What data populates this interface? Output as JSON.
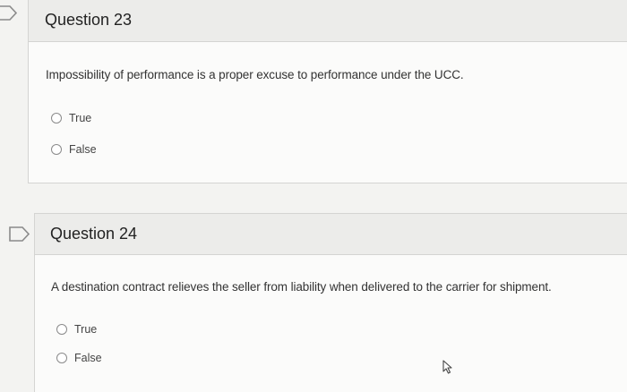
{
  "questions": [
    {
      "title": "Question 23",
      "prompt": "Impossibility of performance is a proper excuse to performance under the UCC.",
      "options": [
        "True",
        "False"
      ]
    },
    {
      "title": "Question 24",
      "prompt": "A destination contract relieves the seller from liability when delivered to the carrier for shipment.",
      "options": [
        "True",
        "False"
      ]
    }
  ],
  "icons": {
    "flag": "flag-outline-icon",
    "cursor": "mouse-pointer-icon"
  },
  "colors": {
    "page_bg": "#f3f3f1",
    "header_bg": "#ececea",
    "card_bg": "#fbfbfa",
    "border": "#d4d4d2"
  }
}
